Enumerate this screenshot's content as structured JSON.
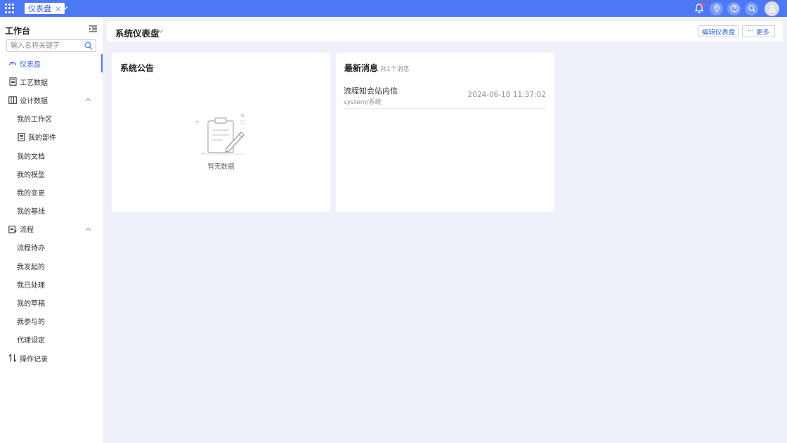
{
  "topbar": {
    "tab_label": "仪表盘",
    "tab_close": "×",
    "icons": [
      "bell-icon",
      "location-icon",
      "help-icon",
      "search-icon",
      "user-avatar"
    ],
    "accent": "#4d78f5"
  },
  "sidebar": {
    "title": "工作台",
    "search_placeholder": "输入名称关键字",
    "items": [
      {
        "label": "仪表盘",
        "icon": "dashboard-icon",
        "active": true
      },
      {
        "label": "工艺数据",
        "icon": "document-icon"
      },
      {
        "label": "设计数据",
        "icon": "library-icon",
        "expanded": true
      },
      {
        "label": "我的工作区"
      },
      {
        "label": "我的部件",
        "icon": "document-icon"
      },
      {
        "label": "我的文档"
      },
      {
        "label": "我的模型"
      },
      {
        "label": "我的变更"
      },
      {
        "label": "我的基线"
      },
      {
        "label": "流程",
        "icon": "process-icon",
        "expanded": true
      },
      {
        "label": "流程待办"
      },
      {
        "label": "我发起的"
      },
      {
        "label": "我已处理"
      },
      {
        "label": "我的草稿"
      },
      {
        "label": "我参与的"
      },
      {
        "label": "代理设定"
      },
      {
        "label": "操作记录",
        "icon": "swap-icon"
      }
    ]
  },
  "header": {
    "title": "系统仪表盘",
    "edit_label": "编辑仪表盘",
    "more_label": "更多",
    "more_prefix": "···"
  },
  "notice_card": {
    "title": "系统公告",
    "empty_text": "暂无数据"
  },
  "messages_card": {
    "title": "最新消息",
    "count_text": "共1个消息",
    "items": [
      {
        "title": "流程知会站内信",
        "source": "system/系统",
        "time": "2024-06-18 11:37:02"
      }
    ]
  }
}
